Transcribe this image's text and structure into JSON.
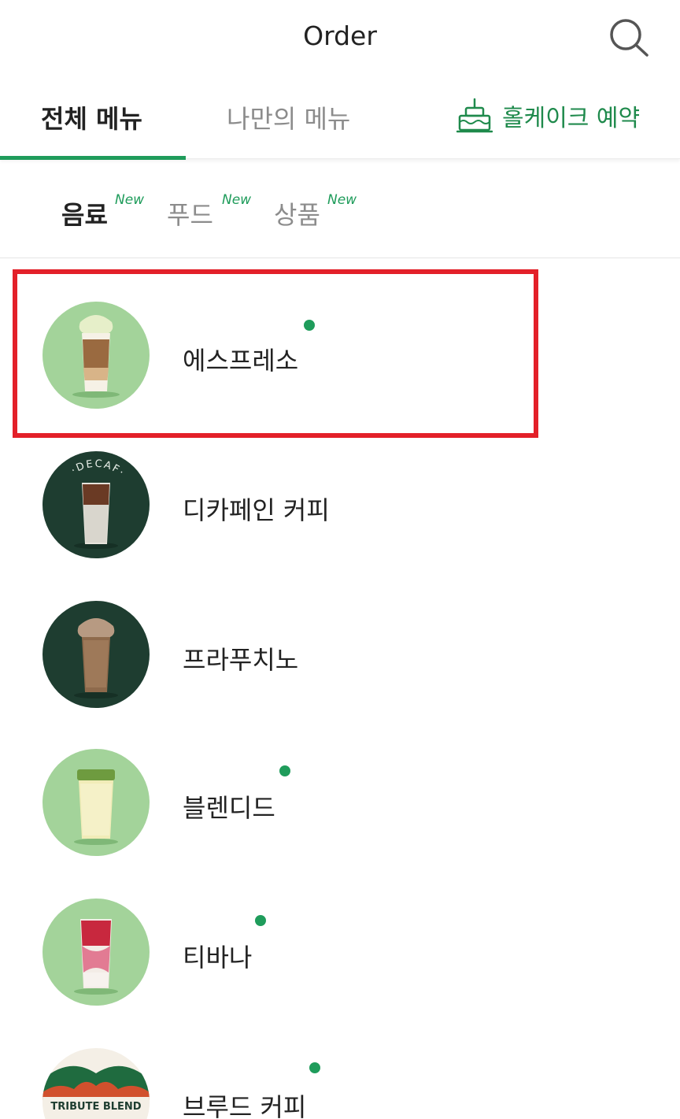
{
  "header": {
    "title": "Order",
    "search_icon": "search-icon"
  },
  "tabs": [
    {
      "label": "전체 메뉴",
      "active": true
    },
    {
      "label": "나만의 메뉴",
      "active": false
    },
    {
      "label": "홀케이크 예약",
      "icon": "cake-icon"
    }
  ],
  "categories": [
    {
      "label": "음료",
      "badge": "New",
      "active": true
    },
    {
      "label": "푸드",
      "badge": "New",
      "active": false
    },
    {
      "label": "상품",
      "badge": "New",
      "active": false
    }
  ],
  "menu_items": [
    {
      "label": "에스프레소",
      "new_dot": true,
      "highlighted": true,
      "thumb": "light-green"
    },
    {
      "label": "디카페인 커피",
      "new_dot": false,
      "thumb": "dark-green",
      "thumb_text": "DECAF"
    },
    {
      "label": "프라푸치노",
      "new_dot": false,
      "thumb": "dark-green"
    },
    {
      "label": "블렌디드",
      "new_dot": true,
      "thumb": "light-green"
    },
    {
      "label": "티바나",
      "new_dot": true,
      "thumb": "light-green"
    },
    {
      "label": "브루드 커피",
      "new_dot": true,
      "thumb": "pattern",
      "thumb_text": "TRIBUTE BLEND"
    }
  ],
  "colors": {
    "accent": "#1f9c5b",
    "highlight": "#e32029",
    "thumb_light": "#a3d39a",
    "thumb_dark": "#1e3d30"
  }
}
